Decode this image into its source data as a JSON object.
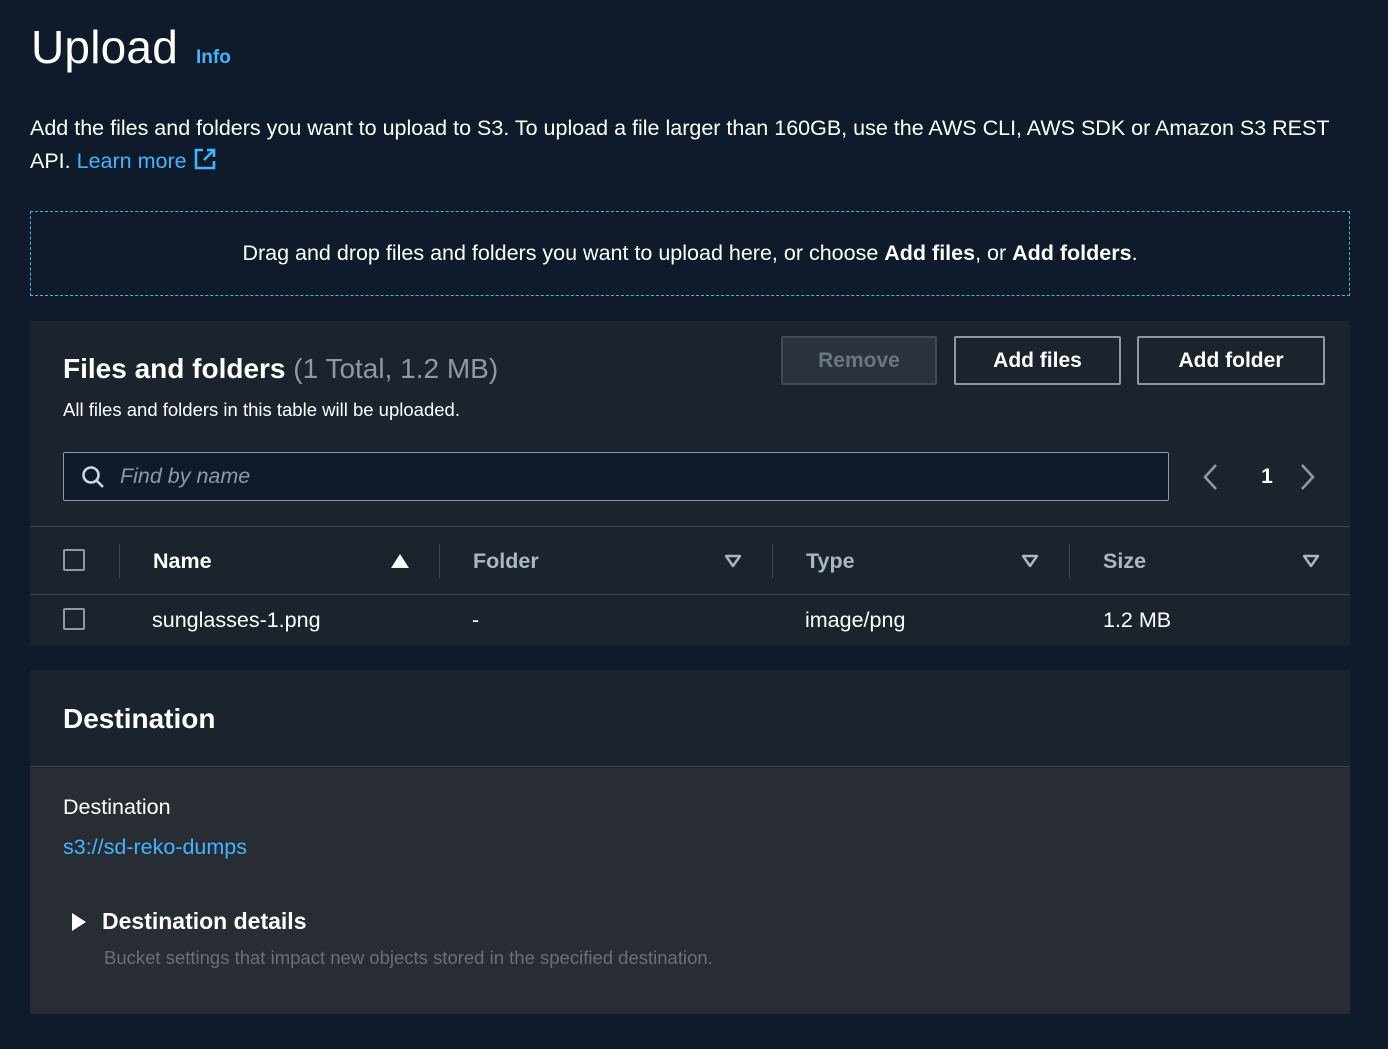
{
  "header": {
    "title": "Upload",
    "info_label": "Info"
  },
  "intro": {
    "text": "Add the files and folders you want to upload to S3. To upload a file larger than 160GB, use the AWS CLI, AWS SDK or Amazon S3 REST API.",
    "learn_more": "Learn more"
  },
  "dropzone": {
    "text_before": "Drag and drop files and folders you want to upload here, or choose ",
    "add_files": "Add files",
    "text_middle": ", or ",
    "add_folders": "Add folders",
    "text_after": "."
  },
  "files": {
    "title": "Files and folders",
    "count": "(1 Total, 1.2 MB)",
    "description": "All files and folders in this table will be uploaded.",
    "remove_label": "Remove",
    "add_files_label": "Add files",
    "add_folder_label": "Add folder",
    "search_placeholder": "Find by name",
    "page": "1",
    "columns": {
      "name": "Name",
      "folder": "Folder",
      "type": "Type",
      "size": "Size"
    },
    "rows": [
      {
        "name": "sunglasses-1.png",
        "folder": "-",
        "type": "image/png",
        "size": "1.2 MB"
      }
    ]
  },
  "destination": {
    "title": "Destination",
    "label": "Destination",
    "value": "s3://sd-reko-dumps",
    "details_title": "Destination details",
    "details_description": "Bucket settings that impact new objects stored in the specified destination."
  },
  "colors": {
    "background": "#0f1b2a",
    "panel": "#1b232d",
    "link": "#42b4ff",
    "dropzone_border": "#44b9d6"
  },
  "icons": [
    "external-link-icon",
    "search-icon",
    "chevron-left-icon",
    "chevron-right-icon",
    "sort-ascending-icon",
    "sort-descending-icon",
    "caret-right-icon"
  ]
}
